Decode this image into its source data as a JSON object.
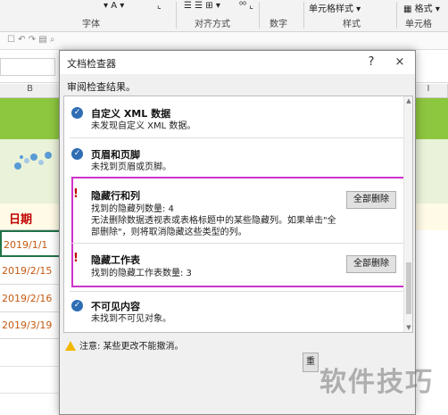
{
  "ribbon": {
    "font_group": "字体",
    "align_group": "对齐方式",
    "number_group": "数字",
    "styles_group": "样式",
    "cells_group": "单元格",
    "cell_style_btn": "单元格样式",
    "format_btn": "格式"
  },
  "sheet": {
    "col_b": "B",
    "col_i": "I",
    "date_header": "日期",
    "dates": [
      "2019/1/1",
      "2019/2/15",
      "2019/2/16",
      "2019/3/19"
    ]
  },
  "dialog": {
    "title": "文档检查器",
    "help": "?",
    "close": "×",
    "subtitle": "审阅检查结果。",
    "items": [
      {
        "title": "自定义 XML 数据",
        "desc": "未发现自定义 XML 数据。"
      },
      {
        "title": "页眉和页脚",
        "desc": "未找到页眉或页脚。"
      },
      {
        "title": "隐藏行和列",
        "desc_1": "找到的隐藏列数量: 4",
        "desc_2": "无法删除数据透视表或表格标题中的某些隐藏列。如果单击\"全部删除\"，则将取消隐藏这些类型的列。",
        "button": "全部删除"
      },
      {
        "title": "隐藏工作表",
        "desc": "找到的隐藏工作表数量: 3",
        "button": "全部删除"
      },
      {
        "title": "不可见内容",
        "desc": "未找到不可见对象。"
      }
    ],
    "footer_note": "注意: 某些更改不能撤消。",
    "bottom_button": "重"
  },
  "watermark": "软件技巧",
  "colors": {
    "accent_check": "#2e6db4",
    "warn_red": "#c00000",
    "highlight": "#cc33cc",
    "sheet_green": "#8dc63f"
  }
}
